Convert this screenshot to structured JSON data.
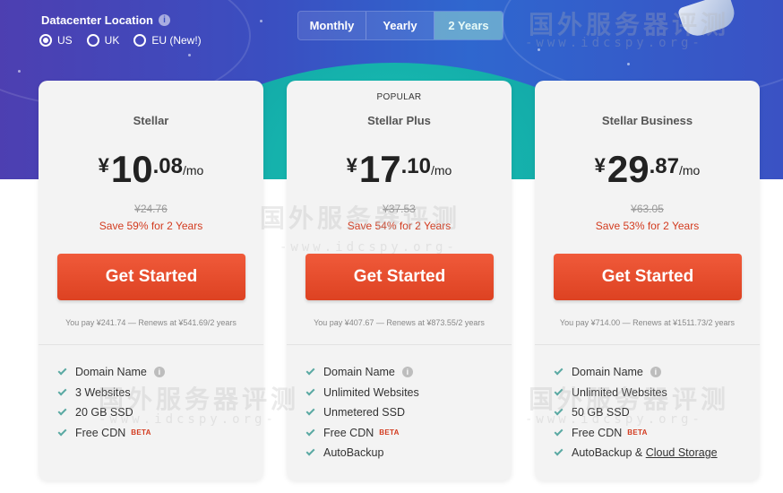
{
  "datacenter": {
    "title": "Datacenter Location",
    "info_glyph": "i",
    "options": [
      {
        "label": "US",
        "selected": true
      },
      {
        "label": "UK",
        "selected": false
      },
      {
        "label": "EU (New!)",
        "selected": false
      }
    ]
  },
  "terms": {
    "monthly": "Monthly",
    "yearly": "Yearly",
    "two_years": "2 Years",
    "selected": "2 Years"
  },
  "plans": [
    {
      "badge": "",
      "name": "Stellar",
      "currency": "¥",
      "price_whole": "10",
      "price_cents": ".08",
      "per": "/mo",
      "old_price": "¥24.76",
      "save": "Save 59% for 2 Years",
      "cta": "Get Started",
      "pay_note": "You pay ¥241.74 — Renews at ¥541.69/2 years",
      "features": [
        "Domain Name",
        "3 Websites",
        "20 GB SSD",
        "Free CDN"
      ]
    },
    {
      "badge": "POPULAR",
      "name": "Stellar Plus",
      "currency": "¥",
      "price_whole": "17",
      "price_cents": ".10",
      "per": "/mo",
      "old_price": "¥37.53",
      "save": "Save 54% for 2 Years",
      "cta": "Get Started",
      "pay_note": "You pay ¥407.67 — Renews at ¥873.55/2 years",
      "features": [
        "Domain Name",
        "Unlimited Websites",
        "Unmetered SSD",
        "Free CDN",
        "AutoBackup"
      ]
    },
    {
      "badge": "",
      "name": "Stellar Business",
      "currency": "¥",
      "price_whole": "29",
      "price_cents": ".87",
      "per": "/mo",
      "old_price": "¥63.05",
      "save": "Save 53% for 2 Years",
      "cta": "Get Started",
      "pay_note": "You pay ¥714.00 — Renews at ¥1511.73/2 years",
      "features": [
        "Domain Name",
        "Unlimited Websites",
        "50 GB SSD",
        "Free CDN",
        "AutoBackup &"
      ],
      "storage_link": "Cloud Storage"
    }
  ],
  "beta_label": "BETA",
  "watermark": {
    "text": "国外服务器评测",
    "url": "-www.idcspy.org-"
  },
  "colors": {
    "accent_button": "#e44a28",
    "save_text": "#d33b1f",
    "check": "#5aa9a3",
    "hero_teal": "#13a9a8",
    "hero_blue": "#3a4fc1"
  }
}
